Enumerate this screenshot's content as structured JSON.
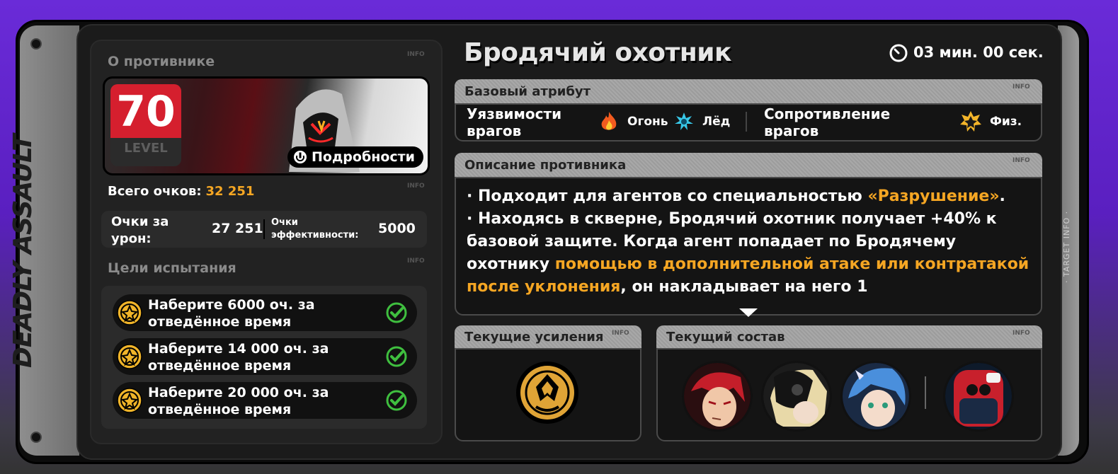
{
  "side_rail": {
    "title": "DEADLY ASSAULT",
    "info": "· TARGET INFO ·"
  },
  "enemy_panel": {
    "section_title": "О противнике",
    "info_tag": "INFO",
    "level_number": "70",
    "level_label": "LEVEL",
    "details_button": "Подробности",
    "total_label": "Всего очков:",
    "total_value": "32 251",
    "damage_label": "Очки за урон:",
    "damage_value": "27 251",
    "efficiency_label": "Очки эффективности:",
    "efficiency_value": "5000",
    "goals_title": "Цели испытания",
    "goals": [
      {
        "text": "Наберите 6000 оч. за отведённое время",
        "done": true
      },
      {
        "text": "Наберите 14 000 оч. за отведённое время",
        "done": true
      },
      {
        "text": "Наберите 20 000 оч. за отведённое время",
        "done": true
      }
    ]
  },
  "main": {
    "enemy_name": "Бродячий охотник",
    "timer": "03 мин. 00 сек.",
    "attribute_header": "Базовый атрибут",
    "weakness_label": "Уязвимости врагов",
    "weaknesses": [
      "Огонь",
      "Лёд"
    ],
    "resistance_label": "Сопротивление врагов",
    "resistances": [
      "Физ."
    ],
    "description_header": "Описание противника",
    "description": {
      "line1": "· Подходит для агентов со специальностью",
      "line1_highlight": "«Разрушение»",
      "line1_end": ".",
      "line2": "· Находясь в скверне, Бродячий охотник получает +40% к базовой защите. Когда агент попадает по Бродячему охотнику",
      "line2_highlight": "помощью в дополнительной атаке или контратакой после уклонения",
      "line2_end": ", он накладывает на него 1"
    },
    "buffs_header": "Текущие усиления",
    "team_header": "Текущий состав",
    "info_tag": "INFO"
  },
  "colors": {
    "accent": "#f5a623",
    "level_red": "#d51f2e",
    "check_green": "#3fbf3f"
  }
}
